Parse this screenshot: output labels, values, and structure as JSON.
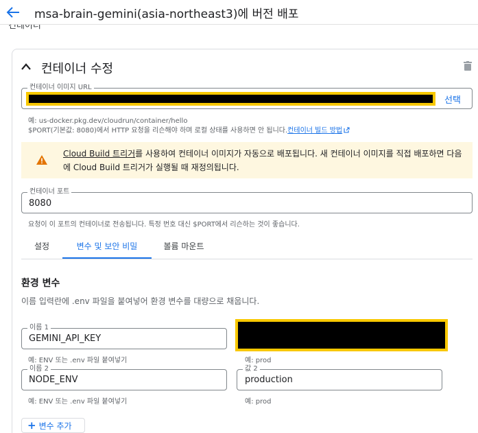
{
  "header": {
    "title": "msa-brain-gemini(asia-northeast3)에 버전 배포"
  },
  "section_cut_text": "컨테이너",
  "panel": {
    "title": "컨테이너 수정"
  },
  "image_url": {
    "label": "컨테이너 이미지 URL",
    "select_label": "선택",
    "hint_line1": "예: us-docker.pkg.dev/cloudrun/container/hello",
    "hint_line2": "$PORT(기본값: 8080)에서 HTTP 요청을 리슨해야 하며 로컬 상태를 사용하면 안 됩니다.",
    "hint_link": "컨테이너 빌드 방법"
  },
  "warning": {
    "link": "Cloud Build 트리거",
    "text": "를 사용하여 컨테이너 이미지가 자동으로 배포됩니다. 새 컨테이너 이미지를 직접 배포하면 다음에 Cloud Build 트리거가 실행될 때 재정의됩니다."
  },
  "port": {
    "label": "컨테이너 포트",
    "value": "8080",
    "hint": "요청이 이 포트의 컨테이너로 전송됩니다. 특정 번호 대신 $PORT에서 리슨하는 것이 좋습니다."
  },
  "tabs": [
    {
      "label": "설정"
    },
    {
      "label": "변수 및 보안 비밀"
    },
    {
      "label": "볼륨 마운트"
    }
  ],
  "env": {
    "heading": "환경 변수",
    "description": "이름 입력란에 .env 파일을 붙여넣어 환경 변수를 대량으로 채웁니다.",
    "rows": [
      {
        "name_label": "이름 1",
        "name": "GEMINI_API_KEY",
        "name_hint": "예: ENV 또는 .env 파일 붙여넣기",
        "value_label": "",
        "value": "",
        "value_hint": "예: prod"
      },
      {
        "name_label": "이름 2",
        "name": "NODE_ENV",
        "name_hint": "예: ENV 또는 .env 파일 붙여넣기",
        "value_label": "값 2",
        "value": "production",
        "value_hint": "예: prod"
      }
    ],
    "add_label": "변수 추가"
  },
  "colors": {
    "accent": "#1a73e8",
    "warning_bg": "#fef7e0",
    "redaction_border": "#f8c800"
  }
}
